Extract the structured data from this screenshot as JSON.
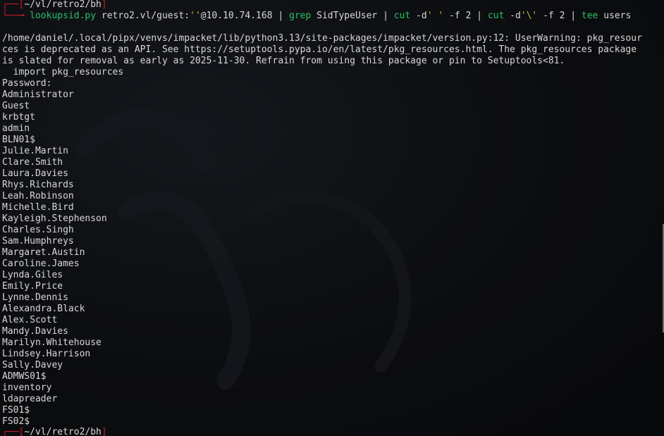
{
  "prompt": {
    "cwd": "~/vl/retro2/bh"
  },
  "command": {
    "tool": "lookupsid.py",
    "target_pre": " retro2.vl/guest:",
    "target_quote": "''",
    "target_post": "@10.10.74.168 ",
    "pipe1": "| ",
    "grep": "grep",
    "grep_arg": " SidTypeUser ",
    "pipe2": "| ",
    "cut1": "cut",
    "cut1_flag": " -d",
    "cut1_delim": "' '",
    "cut1_field": " -f 2 ",
    "pipe3": "| ",
    "cut2": "cut",
    "cut2_flag": " -d",
    "cut2_delim": "'\\'",
    "cut2_field": " -f 2 ",
    "pipe4": "| ",
    "tee": "tee",
    "tee_arg": " users"
  },
  "warning": [
    "/home/daniel/.local/pipx/venvs/impacket/lib/python3.13/site-packages/impacket/version.py:12: UserWarning: pkg_resour",
    "ces is deprecated as an API. See https://setuptools.pypa.io/en/latest/pkg_resources.html. The pkg_resources package",
    "is slated for removal as early as 2025-11-30. Refrain from using this package or pin to Setuptools<81.",
    "  import pkg_resources"
  ],
  "password_prompt": "Password:",
  "users": [
    "Administrator",
    "Guest",
    "krbtgt",
    "admin",
    "BLN01$",
    "Julie.Martin",
    "Clare.Smith",
    "Laura.Davies",
    "Rhys.Richards",
    "Leah.Robinson",
    "Michelle.Bird",
    "Kayleigh.Stephenson",
    "Charles.Singh",
    "Sam.Humphreys",
    "Margaret.Austin",
    "Caroline.James",
    "Lynda.Giles",
    "Emily.Price",
    "Lynne.Dennis",
    "Alexandra.Black",
    "Alex.Scott",
    "Mandy.Davies",
    "Marilyn.Whitehouse",
    "Lindsey.Harrison",
    "Sally.Davey",
    "ADMWS01$",
    "inventory",
    "ldapreader",
    "FS01$",
    "FS02$"
  ],
  "colors": {
    "background": "#0a0b0e",
    "text": "#d8d8d8",
    "prompt_frame": "#c01c28",
    "command": "#26c26a",
    "quote": "#d6b43b"
  }
}
